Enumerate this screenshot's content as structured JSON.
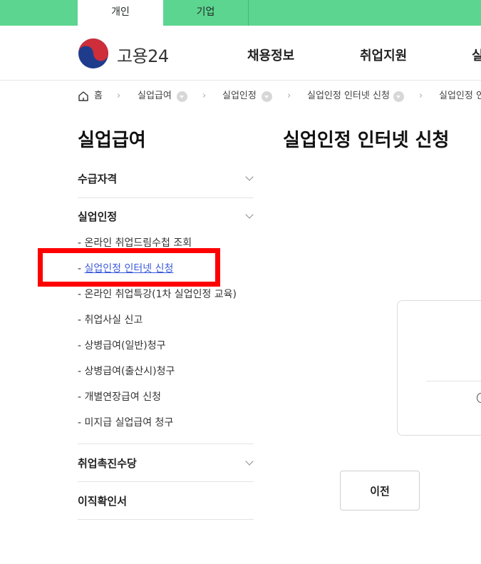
{
  "top_tabs": {
    "personal": "개인",
    "company": "기업"
  },
  "header": {
    "logo_text": "고용24",
    "nav": [
      "채용정보",
      "취업지원",
      "실"
    ]
  },
  "breadcrumb": {
    "home": "홈",
    "items": [
      "실업급여",
      "실업인정",
      "실업인정 인터넷 신청",
      "실업인정 인"
    ]
  },
  "sidebar": {
    "title": "실업급여",
    "sections": [
      {
        "label": "수급자격"
      },
      {
        "label": "실업인정"
      },
      {
        "label": "취업촉진수당"
      },
      {
        "label": "이직확인서"
      }
    ],
    "sub_items": [
      "- 온라인 취업드림수첩 조회",
      "- ",
      "- 온라인 취업특강(1차 실업인정 교육)",
      "- 취업사실 신고",
      "- 상병급여(일반)청구",
      "- 상병급여(출산시)청구",
      "- 개별연장급여 신청",
      "- 미지급 실업급여 청구"
    ],
    "active_link": "실업인정 인터넷 신청"
  },
  "main": {
    "title": "실업인정 인터넷 신청",
    "prev_button": "이전"
  },
  "colors": {
    "brand_green": "#5cd590",
    "link_blue": "#3b5bdb",
    "highlight_red": "#ff0000"
  }
}
